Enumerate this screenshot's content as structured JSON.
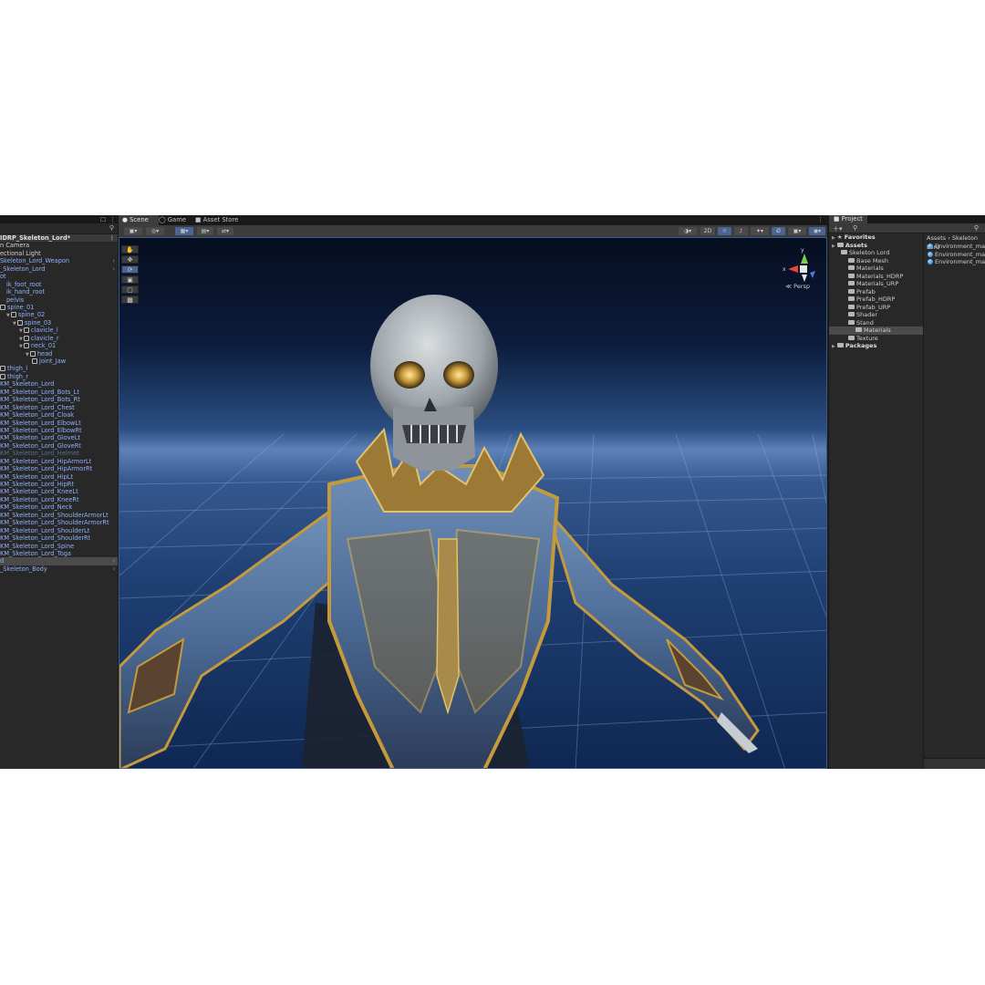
{
  "hierarchy": {
    "scene_name": "IDRP_Skeleton_Lord*",
    "items": [
      {
        "label": "n Camera",
        "kind": "white",
        "indent": 0
      },
      {
        "label": "ectional Light",
        "kind": "white",
        "indent": 0
      },
      {
        "label": "Skeleton_Lord_Weapon",
        "kind": "blue",
        "indent": 0,
        "arrow": true
      },
      {
        "label": "_Skeleton_Lord",
        "kind": "blue",
        "indent": 0,
        "arrow": true
      },
      {
        "label": "ot",
        "kind": "blue",
        "indent": 0
      },
      {
        "label": "ik_foot_root",
        "kind": "blue",
        "indent": 1
      },
      {
        "label": "ik_hand_root",
        "kind": "blue",
        "indent": 1
      },
      {
        "label": "pelvis",
        "kind": "blue",
        "indent": 1
      },
      {
        "label": "spine_01",
        "kind": "blue",
        "indent": 0,
        "cube": true
      },
      {
        "label": "spine_02",
        "kind": "blue",
        "indent": 1,
        "cube": true,
        "tri": true
      },
      {
        "label": "spine_03",
        "kind": "blue",
        "indent": 2,
        "cube": true,
        "tri": true
      },
      {
        "label": "clavicle_l",
        "kind": "blue",
        "indent": 3,
        "cube": true,
        "tri": true
      },
      {
        "label": "clavicle_r",
        "kind": "blue",
        "indent": 3,
        "cube": true,
        "tri": true
      },
      {
        "label": "neck_01",
        "kind": "blue",
        "indent": 3,
        "cube": true,
        "tri": true
      },
      {
        "label": "head",
        "kind": "blue",
        "indent": 4,
        "cube": true,
        "tri": true
      },
      {
        "label": "joint_Jaw",
        "kind": "blue",
        "indent": 5,
        "cube": true
      },
      {
        "label": "thigh_l",
        "kind": "blue",
        "indent": 0,
        "cube": true
      },
      {
        "label": "thigh_r",
        "kind": "blue",
        "indent": 0,
        "cube": true
      },
      {
        "label": "KM_Skeleton_Lord",
        "kind": "blue",
        "indent": 0
      },
      {
        "label": "KM_Skeleton_Lord_Bots_Lt",
        "kind": "blue",
        "indent": 0
      },
      {
        "label": "KM_Skeleton_Lord_Bots_Rt",
        "kind": "blue",
        "indent": 0
      },
      {
        "label": "KM_Skeleton_Lord_Chest",
        "kind": "blue",
        "indent": 0
      },
      {
        "label": "KM_Skeleton_Lord_Cloak",
        "kind": "blue",
        "indent": 0
      },
      {
        "label": "KM_Skeleton_Lord_ElbowLt",
        "kind": "blue",
        "indent": 0
      },
      {
        "label": "KM_Skeleton_Lord_ElbowRt",
        "kind": "blue",
        "indent": 0
      },
      {
        "label": "KM_Skeleton_Lord_GloveLt",
        "kind": "blue",
        "indent": 0
      },
      {
        "label": "KM_Skeleton_Lord_GloveRt",
        "kind": "blue",
        "indent": 0
      },
      {
        "label": "KM_Skeleton_Lord_Helmet",
        "kind": "dim",
        "indent": 0
      },
      {
        "label": "KM_Skeleton_Lord_HipArmorLt",
        "kind": "blue",
        "indent": 0
      },
      {
        "label": "KM_Skeleton_Lord_HipArmorRt",
        "kind": "blue",
        "indent": 0
      },
      {
        "label": "KM_Skeleton_Lord_HipLt",
        "kind": "blue",
        "indent": 0
      },
      {
        "label": "KM_Skeleton_Lord_HipRt",
        "kind": "blue",
        "indent": 0
      },
      {
        "label": "KM_Skeleton_Lord_KneeLt",
        "kind": "blue",
        "indent": 0
      },
      {
        "label": "KM_Skeleton_Lord_KneeRt",
        "kind": "blue",
        "indent": 0
      },
      {
        "label": "KM_Skeleton_Lord_Neck",
        "kind": "blue",
        "indent": 0
      },
      {
        "label": "KM_Skeleton_Lord_ShoulderArmorLt",
        "kind": "blue",
        "indent": 0
      },
      {
        "label": "KM_Skeleton_Lord_ShoulderArmorRt",
        "kind": "blue",
        "indent": 0
      },
      {
        "label": "KM_Skeleton_Lord_ShoulderLt",
        "kind": "blue",
        "indent": 0
      },
      {
        "label": "KM_Skeleton_Lord_ShoulderRt",
        "kind": "blue",
        "indent": 0
      },
      {
        "label": "KM_Skeleton_Lord_Spine",
        "kind": "blue",
        "indent": 0
      },
      {
        "label": "KM_Skeleton_Lord_Toga",
        "kind": "blue",
        "indent": 0
      },
      {
        "label": "d",
        "kind": "sel",
        "indent": 0,
        "arrow": true
      },
      {
        "label": "_Skeleton_Body",
        "kind": "blue",
        "indent": 0,
        "arrow": true
      }
    ]
  },
  "scene_tabs": {
    "scene": "Scene",
    "game": "Game",
    "asset_store": "Asset Store"
  },
  "toolbar": {
    "two_d": "2D"
  },
  "viewport": {
    "projection_label": "Persp",
    "axis_x": "x",
    "axis_y": "y"
  },
  "project": {
    "tab_label": "Project",
    "tree": [
      {
        "label": "Favorites",
        "head": true,
        "indent": 0,
        "icon": "star"
      },
      {
        "label": "Assets",
        "head": true,
        "indent": 0,
        "icon": "folder"
      },
      {
        "label": "Skeleton Lord",
        "indent": 1,
        "icon": "folder"
      },
      {
        "label": "Base Mesh",
        "indent": 2,
        "icon": "folder"
      },
      {
        "label": "Materials",
        "indent": 2,
        "icon": "folder"
      },
      {
        "label": "Materials_HDRP",
        "indent": 2,
        "icon": "folder"
      },
      {
        "label": "Materials_URP",
        "indent": 2,
        "icon": "folder"
      },
      {
        "label": "Prefab",
        "indent": 2,
        "icon": "folder"
      },
      {
        "label": "Prefab_HDRP",
        "indent": 2,
        "icon": "folder"
      },
      {
        "label": "Prefab_URP",
        "indent": 2,
        "icon": "folder"
      },
      {
        "label": "Shader",
        "indent": 2,
        "icon": "folder"
      },
      {
        "label": "Stand",
        "indent": 2,
        "icon": "folder"
      },
      {
        "label": "Materials",
        "indent": 3,
        "icon": "folder",
        "selected": true
      },
      {
        "label": "Texture",
        "indent": 2,
        "icon": "folder"
      },
      {
        "label": "Packages",
        "head": true,
        "indent": 0,
        "icon": "folder"
      }
    ],
    "breadcrumb": [
      "Assets",
      "Skeleton Lord"
    ],
    "files": [
      "Environment_mat",
      "Environment_mat",
      "Environment_mat"
    ]
  },
  "colors": {
    "accent": "#4a6591",
    "hierarchy_blue": "#8fb2ff",
    "panel_bg": "#282828",
    "gold": "#c59a3c"
  }
}
